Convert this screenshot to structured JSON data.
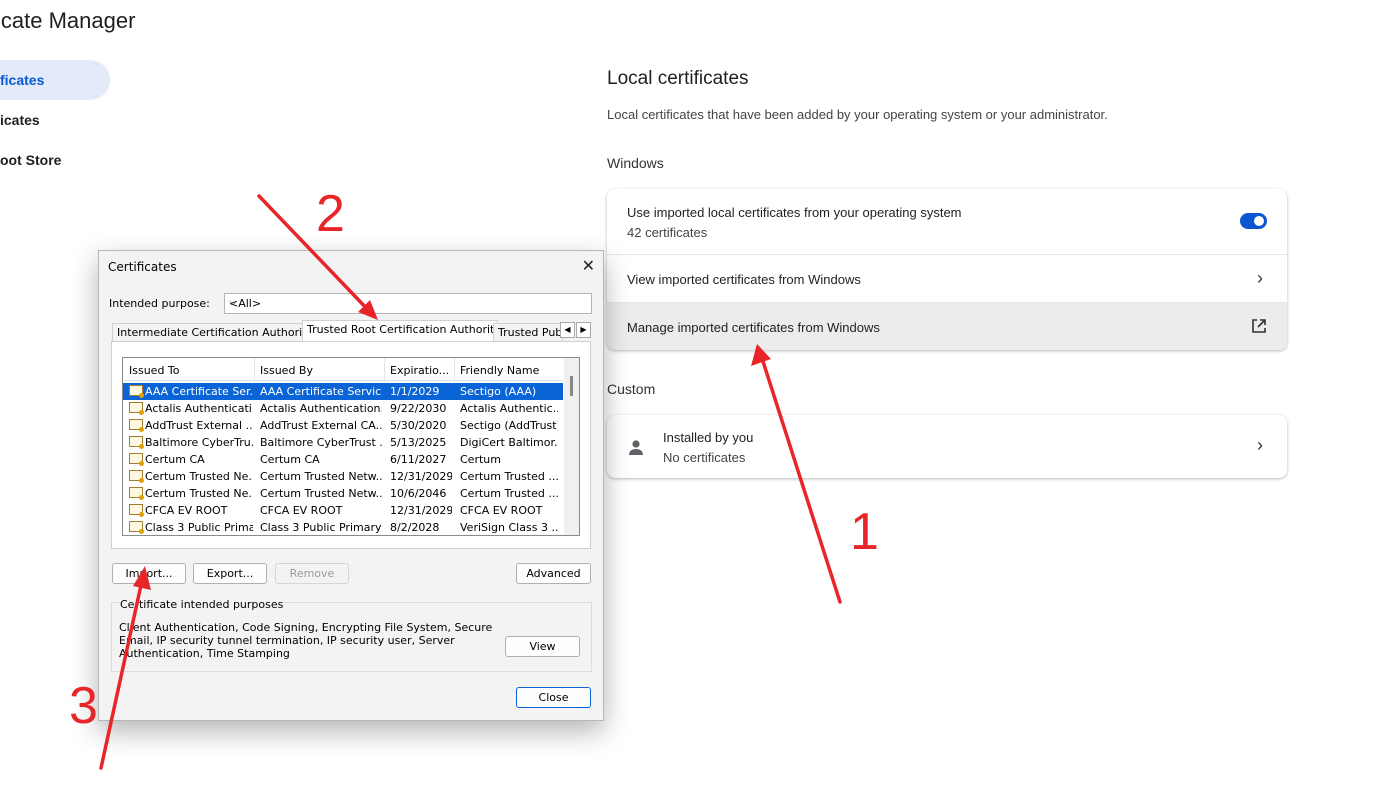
{
  "app": {
    "title": "icate Manager"
  },
  "sidebar": {
    "items": [
      {
        "label": "ficates",
        "active": true
      },
      {
        "label": "icates",
        "active": false
      },
      {
        "label": "oot Store",
        "active": false
      }
    ]
  },
  "main": {
    "heading": "Local certificates",
    "description": "Local certificates that have been added by your operating system or your administrator.",
    "windows_section": "Windows",
    "use_imported_title": "Use imported local certificates from your operating system",
    "use_imported_count": "42 certificates",
    "view_imported": "View imported certificates from Windows",
    "manage_imported": "Manage imported certificates from Windows",
    "custom_section": "Custom",
    "installed_title": "Installed by you",
    "installed_sub": "No certificates"
  },
  "dialog": {
    "title": "Certificates",
    "close_glyph": "✕",
    "purpose_label": "Intended purpose:",
    "purpose_value": "<All>",
    "tabs": [
      "Intermediate Certification Authorities",
      "Trusted Root Certification Authorities",
      "Trusted Publi"
    ],
    "columns": [
      "Issued To",
      "Issued By",
      "Expiratio...",
      "Friendly Name"
    ],
    "rows": [
      [
        "AAA Certificate Ser...",
        "AAA Certificate Services",
        "1/1/2029",
        "Sectigo (AAA)"
      ],
      [
        "Actalis Authenticati...",
        "Actalis Authentication...",
        "9/22/2030",
        "Actalis Authentic..."
      ],
      [
        "AddTrust External ...",
        "AddTrust External CA...",
        "5/30/2020",
        "Sectigo (AddTrust)"
      ],
      [
        "Baltimore CyberTru...",
        "Baltimore CyberTrust ...",
        "5/13/2025",
        "DigiCert Baltimor..."
      ],
      [
        "Certum CA",
        "Certum CA",
        "6/11/2027",
        "Certum"
      ],
      [
        "Certum Trusted Ne...",
        "Certum Trusted Netw...",
        "12/31/2029",
        "Certum Trusted ..."
      ],
      [
        "Certum Trusted Ne...",
        "Certum Trusted Netw...",
        "10/6/2046",
        "Certum Trusted ..."
      ],
      [
        "CFCA EV ROOT",
        "CFCA EV ROOT",
        "12/31/2029",
        "CFCA EV ROOT"
      ],
      [
        "Class 3 Public Prima...",
        "Class 3 Public Primary ...",
        "8/2/2028",
        "VeriSign Class 3 ..."
      ]
    ],
    "buttons": {
      "import": "Import...",
      "export": "Export...",
      "remove": "Remove",
      "advanced": "Advanced",
      "view": "View",
      "close": "Close"
    },
    "purposes_group": "Certificate intended purposes",
    "purposes_text": "Client Authentication, Code Signing, Encrypting File System, Secure Email, IP security tunnel termination, IP security user, Server Authentication, Time Stamping"
  },
  "annotations": {
    "step1": "1",
    "step2": "2",
    "step3": "3",
    "color": "#e8262a"
  },
  "colors": {
    "accent": "#0b57d0",
    "selection": "#0a64d6"
  }
}
